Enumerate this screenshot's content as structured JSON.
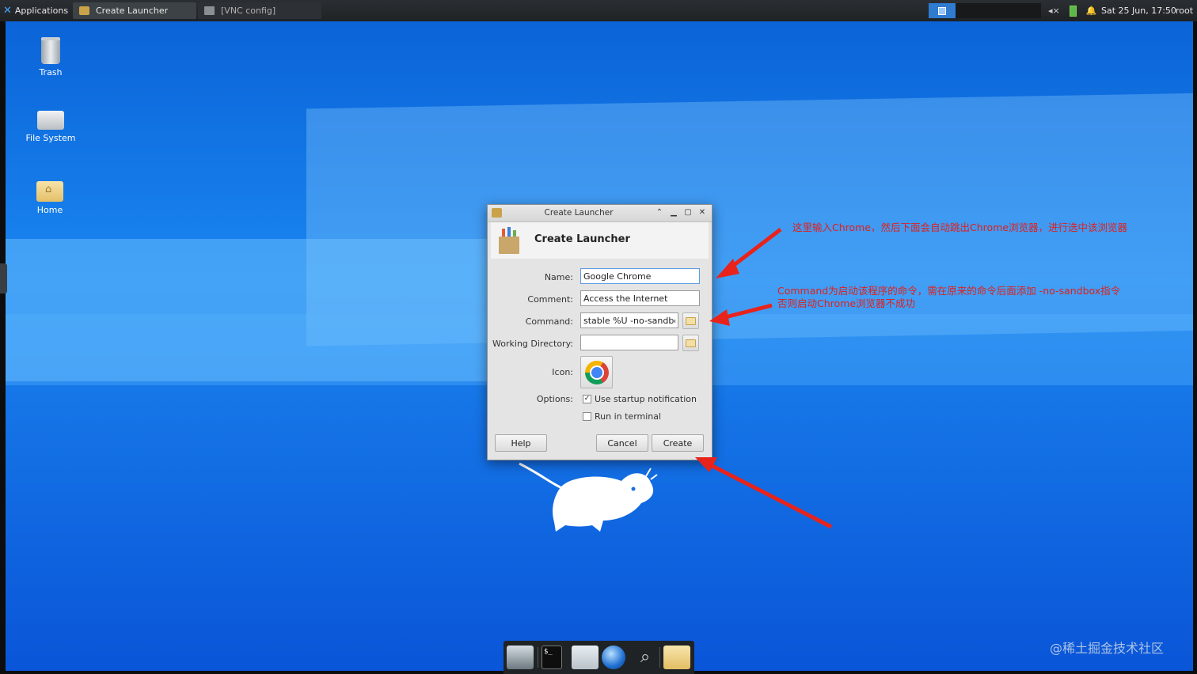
{
  "top_panel": {
    "applications_label": "Applications",
    "tasks": [
      {
        "label": "Create Launcher"
      },
      {
        "label": "[VNC config]"
      }
    ],
    "clock": "Sat 25 Jun, 17:50",
    "user": "root"
  },
  "desktop": {
    "icons": [
      {
        "label": "Trash",
        "icon": "trash-icon"
      },
      {
        "label": "File System",
        "icon": "drive-icon"
      },
      {
        "label": "Home",
        "icon": "home-folder-icon"
      }
    ]
  },
  "dialog": {
    "window_title": "Create Launcher",
    "header_title": "Create Launcher",
    "fields": {
      "name_label": "Name:",
      "name_value": "Google Chrome",
      "comment_label": "Comment:",
      "comment_value": "Access the Internet",
      "command_label": "Command:",
      "command_value": "stable %U -no-sandbox",
      "workdir_label": "Working Directory:",
      "workdir_value": "",
      "icon_label": "Icon:",
      "options_label": "Options:"
    },
    "options": [
      {
        "label": "Use startup notification",
        "checked": true
      },
      {
        "label": "Run in terminal",
        "checked": false
      }
    ],
    "buttons": {
      "help": "Help",
      "cancel": "Cancel",
      "create": "Create"
    }
  },
  "annotations": {
    "note1": "这里输入Chrome，然后下面会自动跳出Chrome浏览器，进行选中该浏览器",
    "note2_line1": "Command为启动该程序的命令，需在原来的命令后面添加 -no-sandbox指令",
    "note2_line2": "否则启动Chrome浏览器不成功",
    "arrow_color": "#e8231c"
  },
  "dock": {
    "terminal_prompt": "$_"
  },
  "watermark": "@稀土掘金技术社区",
  "colors": {
    "accent": "#2f7bd0",
    "annotation": "#e0201c"
  }
}
